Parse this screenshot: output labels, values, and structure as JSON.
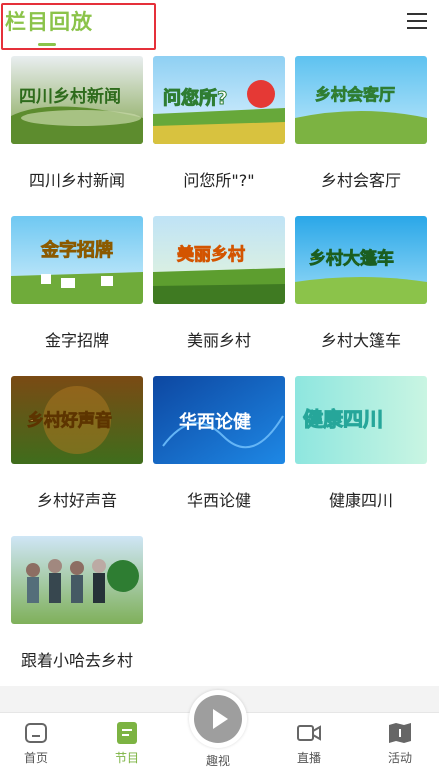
{
  "header": {
    "title": "栏目回放",
    "menu_icon": "hamburger-menu-icon"
  },
  "programs": [
    {
      "name": "四川乡村新闻",
      "art": "四川乡村新闻"
    },
    {
      "name": "问您所\"?\"",
      "art": "问您所?"
    },
    {
      "name": "乡村会客厅",
      "art": "乡村会客厅"
    },
    {
      "name": "金字招牌",
      "art": "金字招牌"
    },
    {
      "name": "美丽乡村",
      "art": "美丽乡村"
    },
    {
      "name": "乡村大篷车",
      "art": "乡村大篷车"
    },
    {
      "name": "乡村好声音",
      "art": "乡村好声音"
    },
    {
      "name": "华西论健",
      "art": "华西论健"
    },
    {
      "name": "健康四川",
      "art": "健康四川"
    },
    {
      "name": "跟着小哈去乡村",
      "art": ""
    }
  ],
  "tabbar": {
    "tabs": [
      {
        "label": "首页",
        "icon": "home-icon"
      },
      {
        "label": "节目",
        "icon": "program-icon",
        "active": true
      },
      {
        "label": "趣视",
        "icon": "play-icon"
      },
      {
        "label": "直播",
        "icon": "video-camera-icon"
      },
      {
        "label": "活动",
        "icon": "map-book-icon"
      }
    ]
  },
  "colors": {
    "accent": "#8bc34a",
    "highlight_box": "#e5303a"
  }
}
